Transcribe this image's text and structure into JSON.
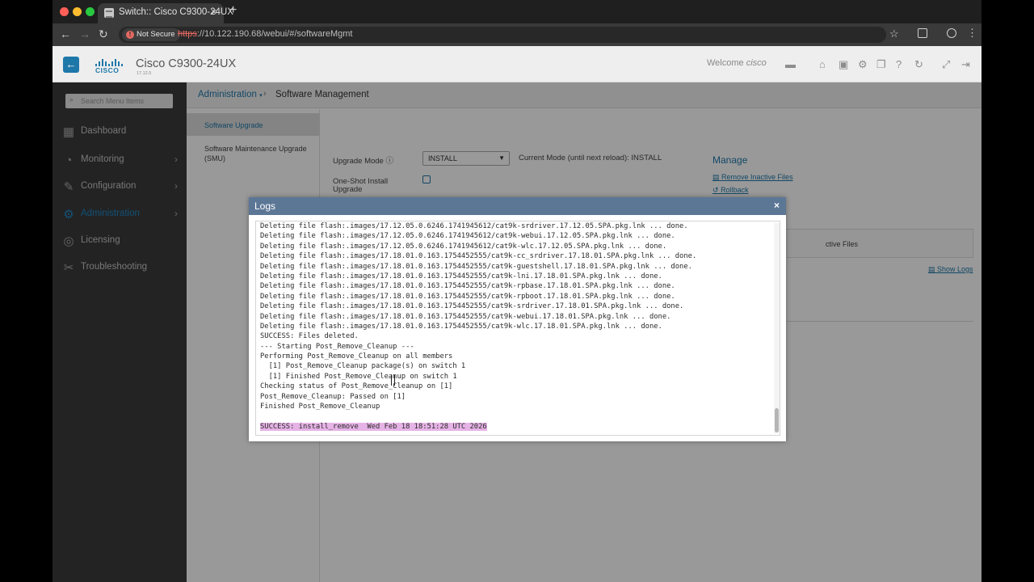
{
  "browser": {
    "tab_title": "Switch:: Cisco C9300-24UX",
    "tab_close": "×",
    "new_tab": "+",
    "security_label": "Not Secure",
    "url_scheme": "https",
    "url_rest": "://10.122.190.68/webui/#/softwareMgmt"
  },
  "header": {
    "logo_text": "CISCO",
    "device_name": "Cisco C9300-24UX",
    "device_version": "17.12.5",
    "welcome": "Welcome",
    "user": "cisco"
  },
  "sidebar": {
    "search_placeholder": "Search Menu Items",
    "items": [
      {
        "label": "Dashboard",
        "icon": "dashboard-icon"
      },
      {
        "label": "Monitoring",
        "icon": "monitoring-icon"
      },
      {
        "label": "Configuration",
        "icon": "wrench-icon"
      },
      {
        "label": "Administration",
        "icon": "gear-icon"
      },
      {
        "label": "Licensing",
        "icon": "licensing-icon"
      },
      {
        "label": "Troubleshooting",
        "icon": "tools-icon"
      }
    ],
    "active": "Administration"
  },
  "breadcrumb": {
    "parent": "Administration",
    "separator": "›",
    "current": "Software Management"
  },
  "subnav": {
    "upgrade": "Software Upgrade",
    "smu": "Software Maintenance Upgrade (SMU)"
  },
  "upgrade_form": {
    "mode_label": "Upgrade Mode",
    "mode_value": "INSTALL",
    "current_mode": "Current Mode (until next reload): INSTALL",
    "oneshot_label": "One-Shot Install Upgrade"
  },
  "manage": {
    "title": "Manage",
    "remove_inactive": "Remove Inactive Files",
    "rollback": "Rollback",
    "inactive_files_label": "ctive Files",
    "show_logs": "Show Logs"
  },
  "modal": {
    "title": "Logs",
    "close": "×",
    "log_lines": [
      "Deleting file flash:.images/17.12.05.0.6246.1741945612/cat9k-srdriver.17.12.05.SPA.pkg.lnk ... done.",
      "Deleting file flash:.images/17.12.05.0.6246.1741945612/cat9k-webui.17.12.05.SPA.pkg.lnk ... done.",
      "Deleting file flash:.images/17.12.05.0.6246.1741945612/cat9k-wlc.17.12.05.SPA.pkg.lnk ... done.",
      "Deleting file flash:.images/17.18.01.0.163.1754452555/cat9k-cc_srdriver.17.18.01.SPA.pkg.lnk ... done.",
      "Deleting file flash:.images/17.18.01.0.163.1754452555/cat9k-guestshell.17.18.01.SPA.pkg.lnk ... done.",
      "Deleting file flash:.images/17.18.01.0.163.1754452555/cat9k-lni.17.18.01.SPA.pkg.lnk ... done.",
      "Deleting file flash:.images/17.18.01.0.163.1754452555/cat9k-rpbase.17.18.01.SPA.pkg.lnk ... done.",
      "Deleting file flash:.images/17.18.01.0.163.1754452555/cat9k-rpboot.17.18.01.SPA.pkg.lnk ... done.",
      "Deleting file flash:.images/17.18.01.0.163.1754452555/cat9k-srdriver.17.18.01.SPA.pkg.lnk ... done.",
      "Deleting file flash:.images/17.18.01.0.163.1754452555/cat9k-webui.17.18.01.SPA.pkg.lnk ... done.",
      "Deleting file flash:.images/17.18.01.0.163.1754452555/cat9k-wlc.17.18.01.SPA.pkg.lnk ... done.",
      "SUCCESS: Files deleted.",
      "--- Starting Post_Remove_Cleanup ---",
      "Performing Post_Remove_Cleanup on all members",
      "  [1] Post_Remove_Cleanup package(s) on switch 1",
      "  [1] Finished Post_Remove_Cleanup on switch 1",
      "Checking status of Post_Remove_Cleanup on [1]",
      "Post_Remove_Cleanup: Passed on [1]",
      "Finished Post_Remove_Cleanup",
      "",
      "SUCCESS: install_remove  Wed Feb 18 18:51:28 UTC 2026"
    ]
  },
  "colors": {
    "accent": "#1e77a9",
    "sidebar_bg": "#3b3b3b",
    "modal_header": "#5c7796",
    "highlight": "#e6b3e6"
  }
}
